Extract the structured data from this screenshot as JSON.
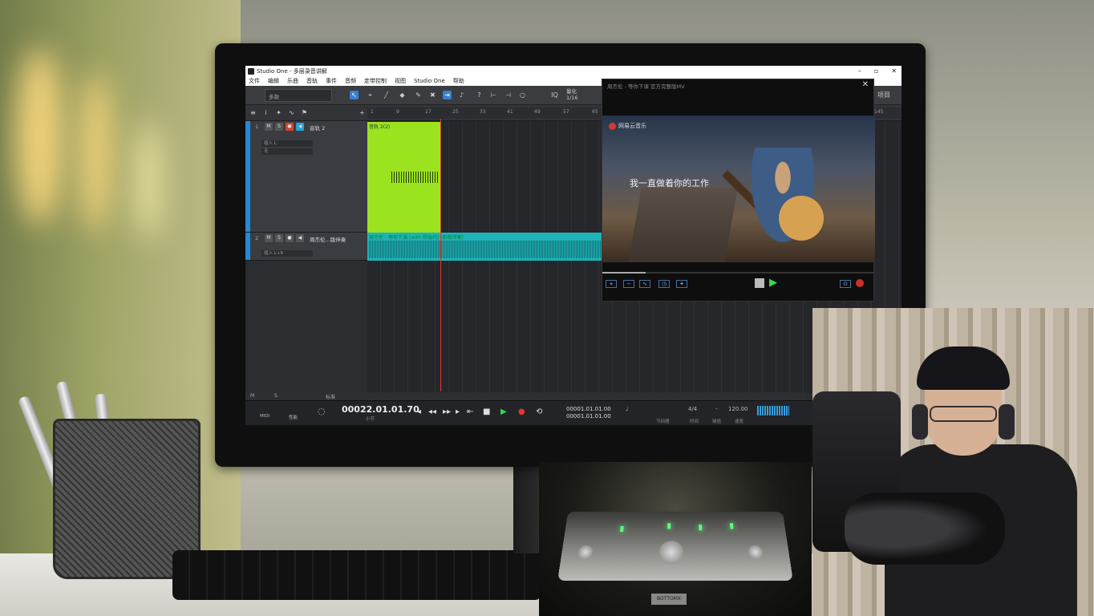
{
  "window": {
    "title": "Studio One - 多层录音讲解",
    "controls": [
      "–",
      "▫",
      "✕"
    ]
  },
  "menu": [
    "文件",
    "编辑",
    "乐曲",
    "音轨",
    "事件",
    "音频",
    "走带控制",
    "视图",
    "Studio One",
    "帮助"
  ],
  "toolbar": {
    "preset": "多款",
    "quantize_label": "量化",
    "quantize_value": "1/16",
    "iq_label": "IQ",
    "right_label": "项目"
  },
  "ruler": [
    "1",
    "9",
    "17",
    "25",
    "33",
    "41",
    "49",
    "57",
    "65",
    "145"
  ],
  "tracks": [
    {
      "number": "1",
      "mute": "M",
      "solo": "S",
      "name": "音轨 2",
      "insert": "插入 L",
      "output": "无",
      "clip_label": "音轨 2(2)"
    },
    {
      "number": "2",
      "mute": "M",
      "solo": "S",
      "name": "周杰伦...版伴奏",
      "insert": "插入 L+R",
      "clip_label": "周杰伦 - 等你下课 (with 杨瑞代) (原版伴奏)"
    }
  ],
  "status_strip": {
    "m": "M",
    "s": "S",
    "mode": "标准"
  },
  "transport": {
    "midi_label": "MIDI",
    "perf_label": "性能",
    "time_main": "00022.01.01.70",
    "time_sub": "小节",
    "loop_start": "00001.01.01.00",
    "loop_end": "00001.01.01.00",
    "time_sig": "4/4",
    "time_sig_label": "时间",
    "key_value": "-",
    "key_label": "键值",
    "tempo": "120.00",
    "tempo_label": "速度",
    "metronome_label": "节拍器"
  },
  "video": {
    "title": "周杰伦 - 等你下课 官方完整版MV",
    "brand": "网易云音乐",
    "lyric": "我一直做着你的工作",
    "progress": 0.16
  },
  "device": {
    "logo": "BOTTOMX"
  }
}
